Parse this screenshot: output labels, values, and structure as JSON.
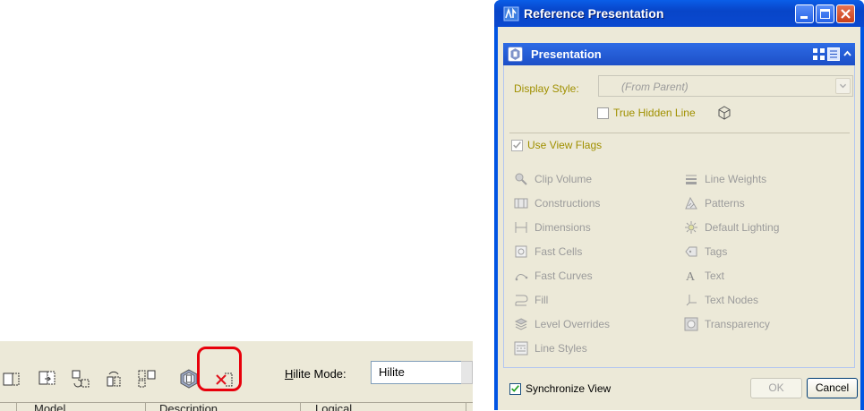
{
  "toolbar": {
    "hilite_label_prefix": "H",
    "hilite_label_rest": "ilite Mode:",
    "hilite_value": "Hilite",
    "icons": [
      "attach-reference-icon",
      "reload-reference-icon",
      "move-reference-icon",
      "rotate-reference-icon",
      "reference-layout-icon",
      "presentation-icon",
      "detach-reference-icon"
    ],
    "columns": [
      "Model",
      "Description",
      "Logical"
    ]
  },
  "dialog": {
    "title": "Reference Presentation",
    "section_title": "Presentation",
    "display_style_label": "Display Style:",
    "display_style_value": "(From Parent)",
    "true_hidden_line_label": "True Hidden Line",
    "use_view_flags_label": "Use View Flags",
    "use_view_flags_checked": true,
    "flags_left": [
      {
        "label": "Clip Volume",
        "icon": "clip-volume-icon"
      },
      {
        "label": "Constructions",
        "icon": "constructions-icon"
      },
      {
        "label": "Dimensions",
        "icon": "dimensions-icon"
      },
      {
        "label": "Fast Cells",
        "icon": "fast-cells-icon"
      },
      {
        "label": "Fast Curves",
        "icon": "fast-curves-icon"
      },
      {
        "label": "Fill",
        "icon": "fill-icon"
      },
      {
        "label": "Level Overrides",
        "icon": "level-overrides-icon"
      },
      {
        "label": "Line Styles",
        "icon": "line-styles-icon"
      }
    ],
    "flags_right": [
      {
        "label": "Line Weights",
        "icon": "line-weights-icon"
      },
      {
        "label": "Patterns",
        "icon": "patterns-icon"
      },
      {
        "label": "Default Lighting",
        "icon": "default-lighting-icon"
      },
      {
        "label": "Tags",
        "icon": "tags-icon"
      },
      {
        "label": "Text",
        "icon": "text-icon"
      },
      {
        "label": "Text Nodes",
        "icon": "text-nodes-icon"
      },
      {
        "label": "Transparency",
        "icon": "transparency-icon"
      }
    ],
    "synchronize_view_label": "Synchronize View",
    "synchronize_view_checked": true,
    "ok_label": "OK",
    "cancel_label": "Cancel"
  },
  "colors": {
    "titlebar": "#0a4fd4",
    "highlight_ring": "#e8000b",
    "label_gold": "#a09000",
    "disabled_text": "#9b9b9b"
  }
}
